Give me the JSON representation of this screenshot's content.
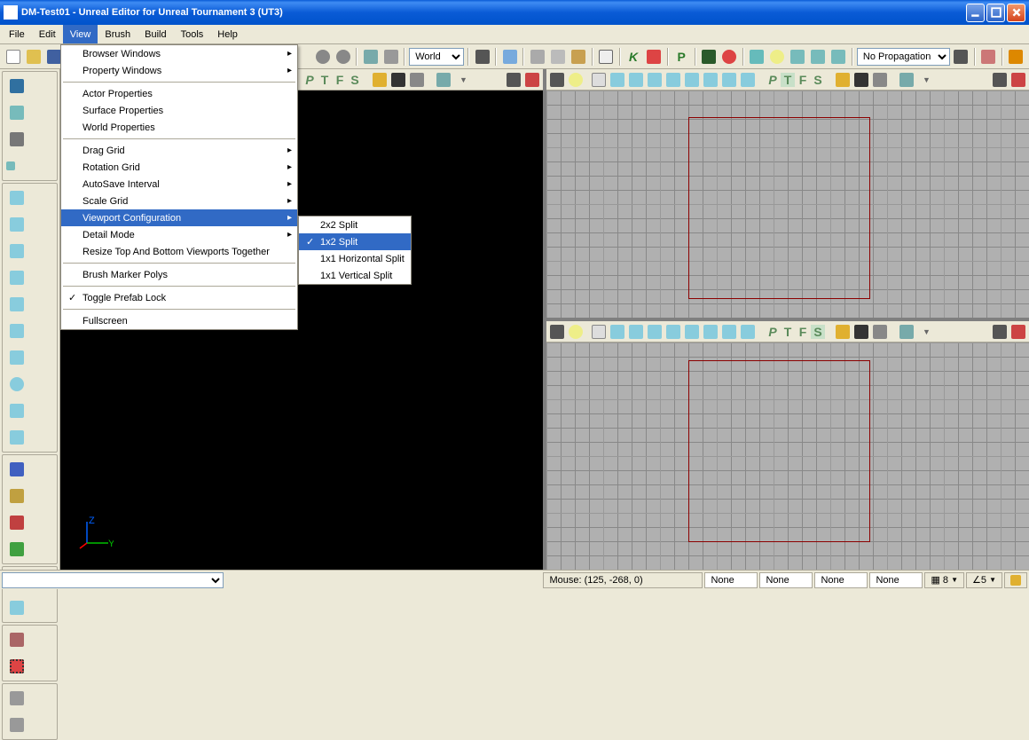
{
  "window": {
    "title": "DM-Test01  - Unreal Editor for Unreal Tournament 3 (UT3)"
  },
  "menubar": {
    "items": [
      "File",
      "Edit",
      "View",
      "Brush",
      "Build",
      "Tools",
      "Help"
    ],
    "open_index": 2
  },
  "main_toolbar": {
    "world_combo": "World",
    "propagation_combo": "No Propagation"
  },
  "view_menu": {
    "items": [
      {
        "label": "Browser Windows",
        "sub": true
      },
      {
        "label": "Property Windows",
        "sub": true
      },
      {
        "sep": true
      },
      {
        "label": "Actor Properties"
      },
      {
        "label": "Surface Properties"
      },
      {
        "label": "World Properties"
      },
      {
        "sep": true
      },
      {
        "label": "Drag Grid",
        "sub": true
      },
      {
        "label": "Rotation Grid",
        "sub": true
      },
      {
        "label": "AutoSave Interval",
        "sub": true
      },
      {
        "label": "Scale Grid",
        "sub": true
      },
      {
        "label": "Viewport Configuration",
        "sub": true,
        "hl": true
      },
      {
        "label": "Detail Mode",
        "sub": true
      },
      {
        "label": "Resize Top And Bottom Viewports Together"
      },
      {
        "sep": true
      },
      {
        "label": "Brush Marker Polys"
      },
      {
        "sep": true
      },
      {
        "label": "Toggle Prefab Lock",
        "checked": true
      },
      {
        "sep": true
      },
      {
        "label": "Fullscreen"
      }
    ]
  },
  "sub_menu": {
    "items": [
      {
        "label": "2x2 Split"
      },
      {
        "label": "1x2 Split",
        "hl": true,
        "checked": true
      },
      {
        "label": "1x1 Horizontal Split"
      },
      {
        "label": "1x1 Vertical Split"
      }
    ]
  },
  "viewport_letters": {
    "P": "P",
    "T": "T",
    "F": "F",
    "S": "S"
  },
  "statusbar": {
    "mouse": "Mouse: (125, -268, 0)",
    "cells": [
      "None",
      "None",
      "None",
      "None"
    ],
    "grid_snap": "8",
    "angle_snap": "5"
  }
}
